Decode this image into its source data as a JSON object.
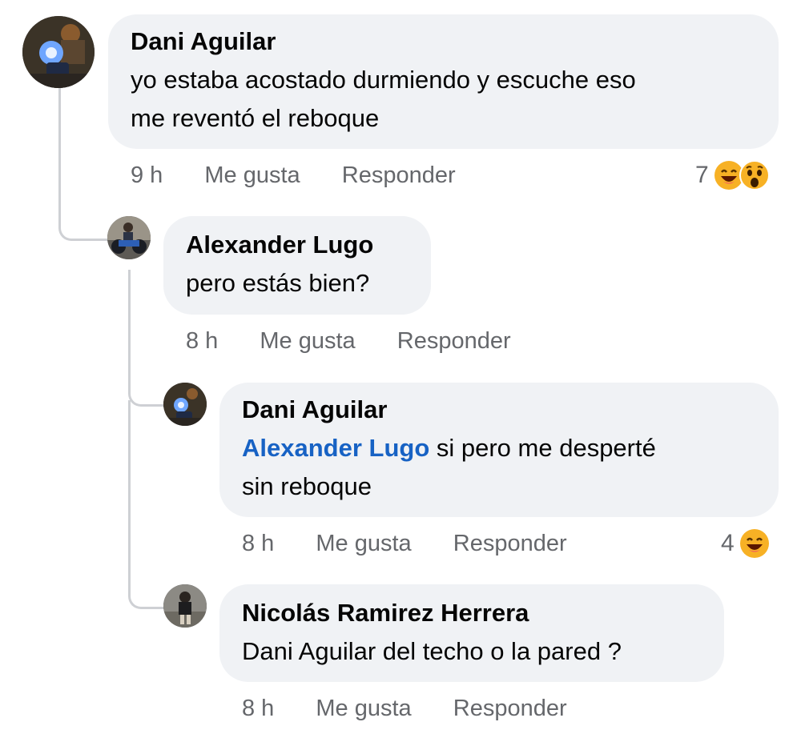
{
  "comments": [
    {
      "author": "Dani Aguilar",
      "text_line1": "yo estaba acostado durmiendo y escuche eso",
      "text_line2": "me reventó el reboque",
      "time": "9 h",
      "like": "Me gusta",
      "reply": "Responder",
      "reaction_count": "7",
      "reactions": [
        "laughing-emoji",
        "wow-emoji"
      ]
    },
    {
      "author": "Alexander Lugo",
      "text": "pero estás bien?",
      "time": "8 h",
      "like": "Me gusta",
      "reply": "Responder"
    },
    {
      "author": "Dani Aguilar",
      "mention": "Alexander Lugo",
      "text_line1": " si pero me desperté",
      "text_line2": "sin reboque",
      "time": "8 h",
      "like": "Me gusta",
      "reply": "Responder",
      "reaction_count": "4",
      "reactions": [
        "laughing-emoji"
      ]
    },
    {
      "author": "Nicolás Ramirez Herrera",
      "text": "Dani Aguilar del techo o la pared ?",
      "time": "8 h",
      "like": "Me gusta",
      "reply": "Responder"
    }
  ],
  "colors": {
    "bubble": "#f0f2f5",
    "meta": "#65676b",
    "mention": "#1762c4",
    "thread_line": "#ced0d4"
  }
}
